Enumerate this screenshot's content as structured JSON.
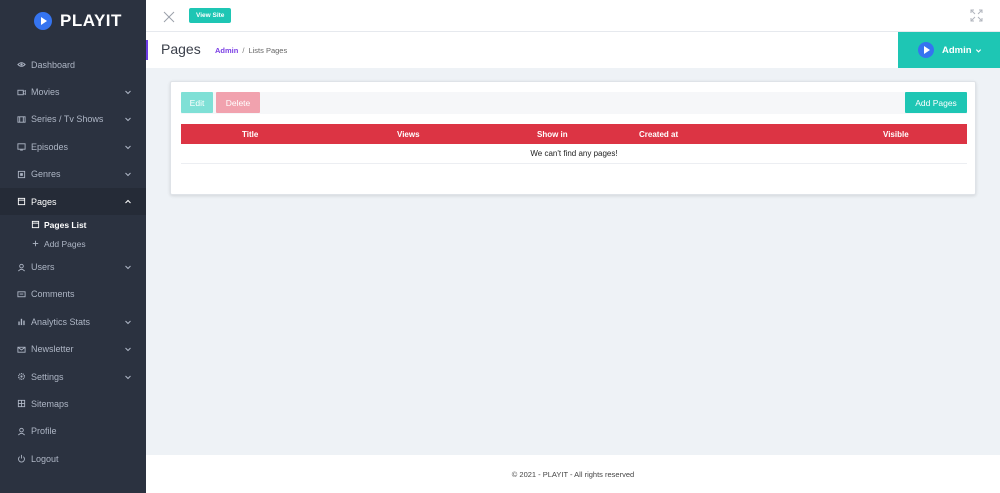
{
  "brand": {
    "name": "PLAYIT"
  },
  "sidebar": {
    "items": [
      {
        "label": "Dashboard",
        "icon": "eye-icon",
        "chevron": false
      },
      {
        "label": "Movies",
        "icon": "video-icon",
        "chevron": true
      },
      {
        "label": "Series / Tv Shows",
        "icon": "film-icon",
        "chevron": true
      },
      {
        "label": "Episodes",
        "icon": "tv-icon",
        "chevron": true
      },
      {
        "label": "Genres",
        "icon": "bookmark-icon",
        "chevron": true
      },
      {
        "label": "Pages",
        "icon": "browser-icon",
        "chevron": true,
        "active": true
      },
      {
        "label": "Users",
        "icon": "user-icon",
        "chevron": true
      },
      {
        "label": "Comments",
        "icon": "comment-icon",
        "chevron": false
      },
      {
        "label": "Analytics Stats",
        "icon": "bar-chart-icon",
        "chevron": true
      },
      {
        "label": "Newsletter",
        "icon": "mail-icon",
        "chevron": true
      },
      {
        "label": "Settings",
        "icon": "gear-icon",
        "chevron": true
      },
      {
        "label": "Sitemaps",
        "icon": "map-icon",
        "chevron": false
      },
      {
        "label": "Profile",
        "icon": "person-icon",
        "chevron": false
      },
      {
        "label": "Logout",
        "icon": "power-icon",
        "chevron": false
      }
    ],
    "pages_sub": [
      {
        "label": "Pages List",
        "icon": "browser-icon"
      },
      {
        "label": "Add Pages",
        "icon": "plus-icon"
      }
    ]
  },
  "topbar": {
    "view_site": "View Site"
  },
  "header": {
    "title": "Pages",
    "breadcrumb": {
      "root": "Admin",
      "sep": "/",
      "current": "Lists Pages"
    },
    "user": "Admin"
  },
  "toolbar": {
    "edit": "Edit",
    "delete": "Delete",
    "add": "Add Pages"
  },
  "table": {
    "columns": [
      "Title",
      "Views",
      "Show in",
      "Created at",
      "Visible"
    ],
    "empty": "We can't find any pages!"
  },
  "footer": {
    "text": "© 2021 - PLAYIT - All rights reserved"
  },
  "colors": {
    "sidebar": "#2b3240",
    "accent": "#1ec6b4",
    "table_header": "#dc3444",
    "brand_blue": "#3574f0",
    "breadcrumb": "#7b3fe4"
  }
}
